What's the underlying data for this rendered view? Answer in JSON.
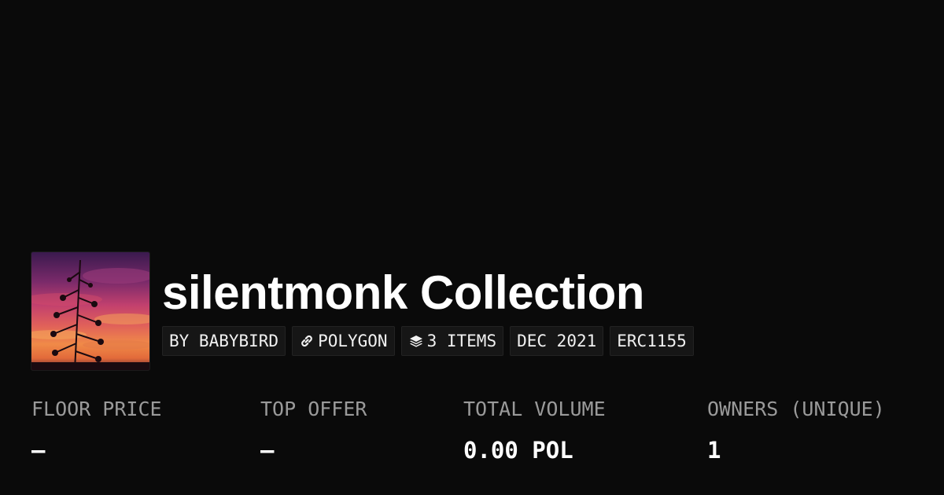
{
  "collection": {
    "title": "silentmonk Collection",
    "image_alt": "collection-avatar-sunset-tree"
  },
  "tags": {
    "creator": "BY BABYBIRD",
    "chain": "POLYGON",
    "chain_icon": "link-icon",
    "items": "3 ITEMS",
    "items_icon": "layers-icon",
    "date": "DEC 2021",
    "standard": "ERC1155"
  },
  "stats": {
    "floor_price": {
      "label": "FLOOR PRICE",
      "value": "—"
    },
    "top_offer": {
      "label": "TOP OFFER",
      "value": "—"
    },
    "total_volume": {
      "label": "TOTAL VOLUME",
      "value": "0.00 POL"
    },
    "owners": {
      "label": "OWNERS (UNIQUE)",
      "value": "1"
    }
  },
  "colors": {
    "background": "#0a0a0a",
    "tag_background": "#161616",
    "label_gray": "#9a9a9a"
  }
}
